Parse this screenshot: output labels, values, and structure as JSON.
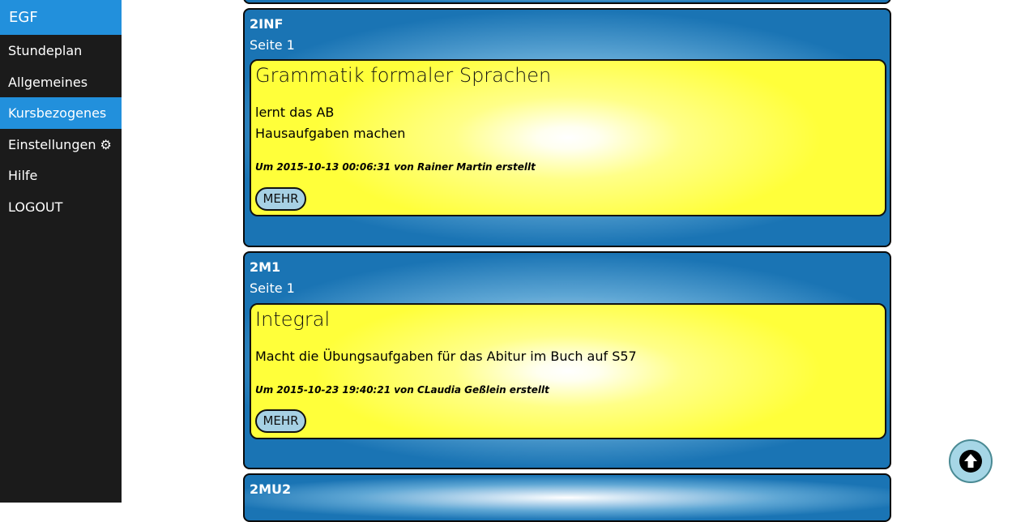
{
  "sidebar": {
    "brand": "EGF",
    "items": [
      {
        "label": "Stundeplan"
      },
      {
        "label": "Allgemeines"
      },
      {
        "label": "Kursbezogenes"
      },
      {
        "label": "Einstellungen ⚙"
      },
      {
        "label": "Hilfe"
      },
      {
        "label": "LOGOUT"
      }
    ],
    "active_item": "Kursbezogenes"
  },
  "courses": [
    {
      "code": "2INF",
      "page": "Seite 1",
      "entry": {
        "title": "Grammatik formaler Sprachen",
        "lines": [
          "lernt das AB",
          "Hausaufgaben machen"
        ],
        "meta": "Um 2015-10-13 00:06:31 von Rainer Martin erstellt",
        "button": "MEHR"
      }
    },
    {
      "code": "2M1",
      "page": "Seite 1",
      "entry": {
        "title": "Integral",
        "lines": [
          "Macht die Übungsaufgaben für das Abitur im Buch auf S57"
        ],
        "meta": "Um 2015-10-23 19:40:21 von CLaudia Geßlein erstellt",
        "button": "MEHR"
      }
    },
    {
      "code": "2MU2"
    }
  ],
  "icons": {
    "scroll_top": "arrow-up-circle-icon"
  },
  "colors": {
    "sidebar_bg": "#1b1b1b",
    "accent": "#2290dc",
    "card_blue": "#1a74b4",
    "entry_yellow": "#ffff3a",
    "button_bg": "#a6d0e4"
  }
}
